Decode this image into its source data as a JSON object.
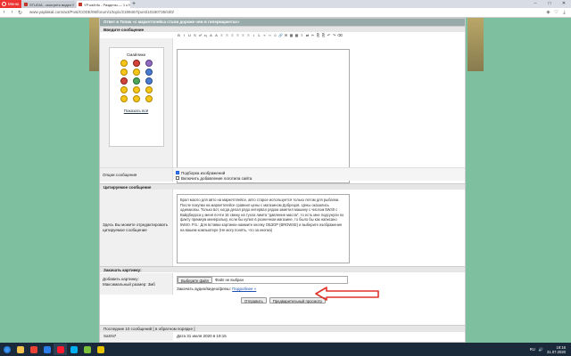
{
  "browser": {
    "menu_label": "Меню",
    "tabs": [
      {
        "title": "STUDIA - смотреть видео",
        "active": false
      },
      {
        "title": "YP.ua/info - Разделы — 1 с",
        "active": true
      }
    ],
    "new_tab_symbol": "+",
    "window_controls": [
      "–",
      "□",
      "✕"
    ],
    "url": "www.yaplakal.com/act/Post/CODE/06/forum/1/topic/2189467/post/10190735/st/0/"
  },
  "form": {
    "header": "Ответ в Топик «с маркетплейса стали дороже чем в гипермаркетах»",
    "enter_message_label": "Введите сообщение",
    "toolbar_buttons": [
      "B",
      "I",
      "U",
      "S",
      "x²",
      "x₂",
      "A",
      "A",
      "≡",
      "≡",
      "≡",
      "≡",
      "≡",
      "≡",
      "•",
      "1.",
      "«",
      "‹›",
      "☺",
      "🔗",
      "✉",
      "▦",
      "▦",
      "≡",
      "⇄",
      "✂",
      "⎘",
      "⎘",
      "↶",
      "↷",
      "⌫"
    ],
    "smilies_title": "Смайлики",
    "show_all_label": "Показать всё",
    "options_label": "Опции сообщения",
    "option_1": "Подборка изображений",
    "option_1_checked": true,
    "option_2": "Включить добавление логотипа сайта",
    "option_2_checked": false,
    "quote_section_label": "Цитируемое сообщение",
    "quote_help": "Здесь Вы можете отредактировать цитируемое сообщение",
    "quote_text": "Брал масло для авто на маркетплейсе, авто старое используется только летом для рыбалки. После покупки на маркетплейсе сравнил цены с магазином Добрецов. Цены оказались одинаковы. Только вот, когда делал рядо интервал рядом заметил машину с числом 5W40 с Вайдберрса у меня почти 15 свежу на тухла лимта \"давление масла\", то есть мне подсунули по факту премиум минеральку, если бы купил в розничном магазине, то было бы как написано 5W40. P.S.: Для вставки картинки нажмите кнопку ОБЗОР (BROWSE) и выберите изображение на вашем компьютере (Не могу понять, что за кнопка)",
    "attach_section_label": "Закачать картинку:",
    "attach_label": "Добавить картинку:",
    "max_size": "Максимальный размер: 3мб",
    "choose_file_button": "Выберите файл",
    "no_file_text": "Файл не выбран",
    "upload_media_text": "Закачать аудио/видео/флеш:",
    "upload_media_link": "Подробнее »",
    "submit_button": "Отправить",
    "preview_button": "Предварительный просмотр"
  },
  "recent": {
    "header": "Последние 10 сообщений [ в обратном порядке ]",
    "rows": [
      {
        "user": "SaSN7",
        "date": "Дата 31 июля 2020 в 19:15"
      }
    ]
  },
  "taskbar": {
    "apps": [
      {
        "icon": "folder-icon",
        "color": "#f2c14e"
      },
      {
        "icon": "chrome-icon",
        "color": "#e94235"
      },
      {
        "icon": "media-icon",
        "color": "#2b7de9"
      },
      {
        "icon": "opera-icon",
        "color": "#ff1b2d"
      },
      {
        "icon": "skype-icon",
        "color": "#00aff0"
      },
      {
        "icon": "app-icon",
        "color": "#7cbf3a"
      },
      {
        "icon": "game-icon",
        "color": "#e6c200"
      }
    ],
    "lang": "RU",
    "time": "19:16",
    "date": "31.07.2020"
  },
  "colors": {
    "page_bg": "#7dbf9e",
    "header_bg": "#99aaaa",
    "arrow": "#e0322b"
  }
}
